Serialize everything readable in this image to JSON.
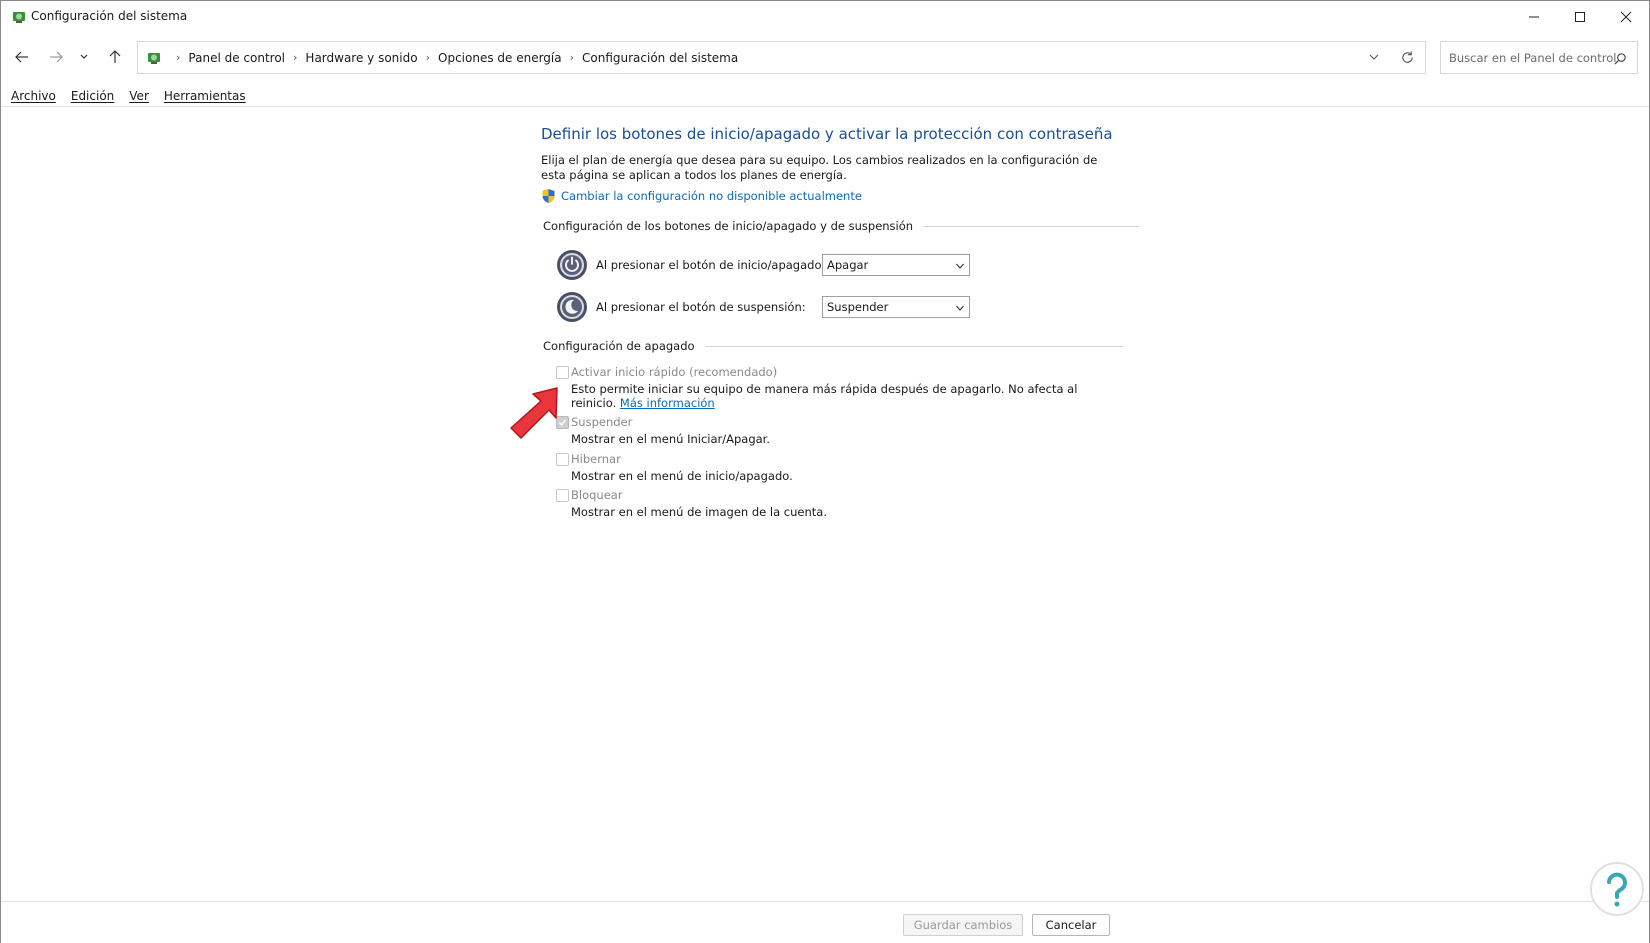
{
  "window": {
    "title": "Configuración del sistema"
  },
  "navigation": {
    "breadcrumbs": [
      "Panel de control",
      "Hardware y sonido",
      "Opciones de energía",
      "Configuración del sistema"
    ],
    "search_placeholder": "Buscar en el Panel de control"
  },
  "menu": {
    "items": [
      "Archivo",
      "Edición",
      "Ver",
      "Herramientas"
    ]
  },
  "content": {
    "title": "Definir los botones de inicio/apagado y activar la protección con contraseña",
    "intro": "Elija el plan de energía que desea para su equipo. Los cambios realizados en la configuración de esta página se aplican a todos los planes de energía.",
    "change_link": "Cambiar la configuración no disponible actualmente",
    "section_buttons": "Configuración de los botones de inicio/apagado y de suspensión",
    "power_button_label": "Al presionar el botón de inicio/apagado:",
    "power_button_value": "Apagar",
    "sleep_button_label": "Al presionar el botón de suspensión:",
    "sleep_button_value": "Suspender",
    "section_shutdown": "Configuración de apagado",
    "options": [
      {
        "label": "Activar inicio rápido (recomendado)",
        "desc": "Esto permite iniciar su equipo de manera más rápida después de apagarlo. No afecta al reinicio.",
        "link": "Más información",
        "checked": false
      },
      {
        "label": "Suspender",
        "desc": "Mostrar en el menú Iniciar/Apagar.",
        "checked": true
      },
      {
        "label": "Hibernar",
        "desc": "Mostrar en el menú de inicio/apagado.",
        "checked": false
      },
      {
        "label": "Bloquear",
        "desc": "Mostrar en el menú de imagen de la cuenta.",
        "checked": false
      }
    ]
  },
  "footer": {
    "save_label": "Guardar cambios",
    "cancel_label": "Cancelar"
  },
  "colors": {
    "title_blue": "#1c4e92",
    "link_blue": "#0b6bb8",
    "annotation_red": "#e8363c"
  }
}
